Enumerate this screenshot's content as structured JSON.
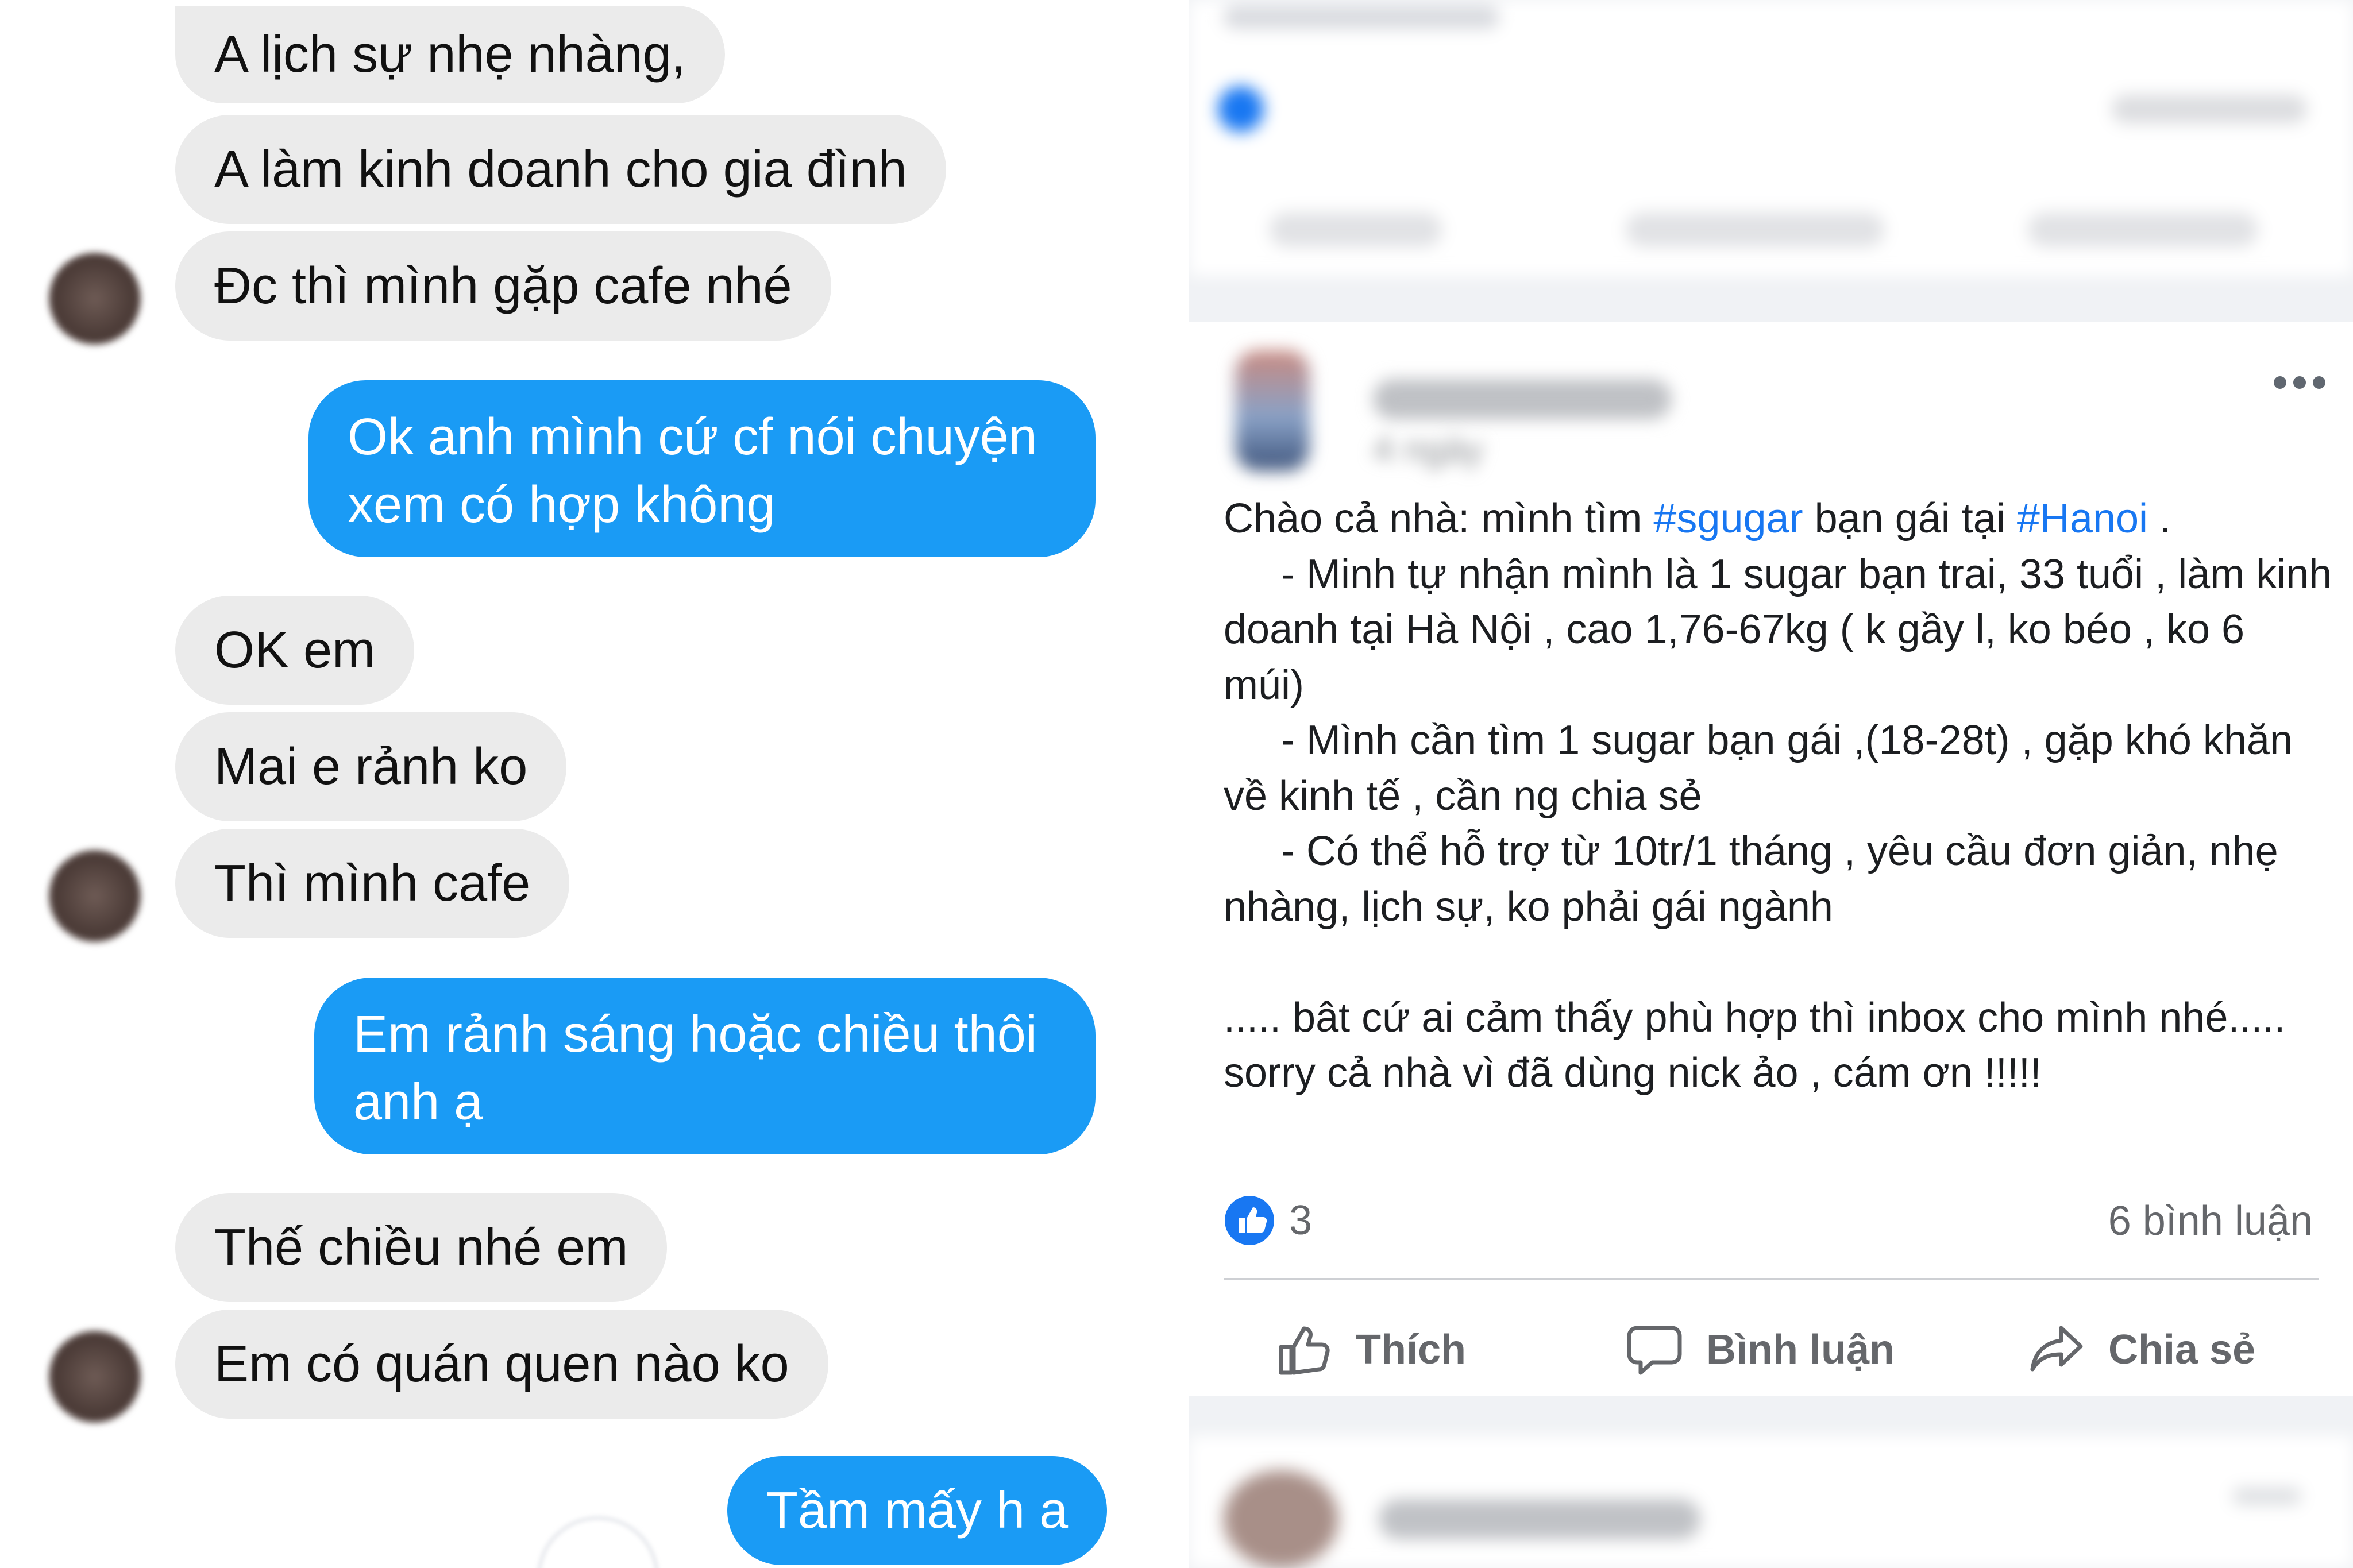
{
  "chat": {
    "incoming_group_1": [
      "A lịch sự nhẹ nhàng,",
      "A làm kinh doanh cho gia đình",
      "Đc thì mình gặp cafe nhé"
    ],
    "outgoing_1": "Ok anh mình cứ cf nói chuyện xem có hợp không",
    "incoming_group_2": [
      "OK em",
      "Mai e rảnh ko",
      "Thì mình cafe"
    ],
    "outgoing_2": "Em rảnh sáng hoặc chiều thôi anh ạ",
    "incoming_group_3": [
      "Thế chiều nhé em",
      "Em có quán quen nào ko"
    ],
    "outgoing_3": "Tầm mấy h a"
  },
  "post": {
    "timestamp": "4 ngày",
    "more_icon": "more-dots-icon",
    "lines": [
      {
        "text_before": "Chào cả nhà: mình tìm ",
        "tag1": "#sgugar",
        "text_mid": " bạn gái tại ",
        "tag2": "#Hanoi",
        "text_after": " ."
      },
      "     - Minh tự nhận mình là 1 sugar bạn trai, 33 tuổi , làm kinh doanh tại Hà Nội , cao 1,76-67kg ( k gầy l, ko béo , ko 6 múi)",
      "     - Mình cần tìm 1 sugar bạn gái ,(18-28t) , gặp khó khăn về kinh tế , cần ng chia sẻ",
      "     - Có thể hỗ trợ từ 10tr/1 tháng , yêu cầu đơn giản, nhẹ nhàng, lịch sự, ko phải gái ngành",
      "",
      "..... bât cứ ai cảm thấy phù hợp thì inbox cho mình nhé..... sorry cả nhà vì đã dùng nick ảo , cám ơn !!!!!"
    ],
    "like_count": "3",
    "comment_count": "6 bình luận",
    "actions": {
      "like": "Thích",
      "comment": "Bình luận",
      "share": "Chia sẻ"
    },
    "accent_color": "#1877f2"
  }
}
